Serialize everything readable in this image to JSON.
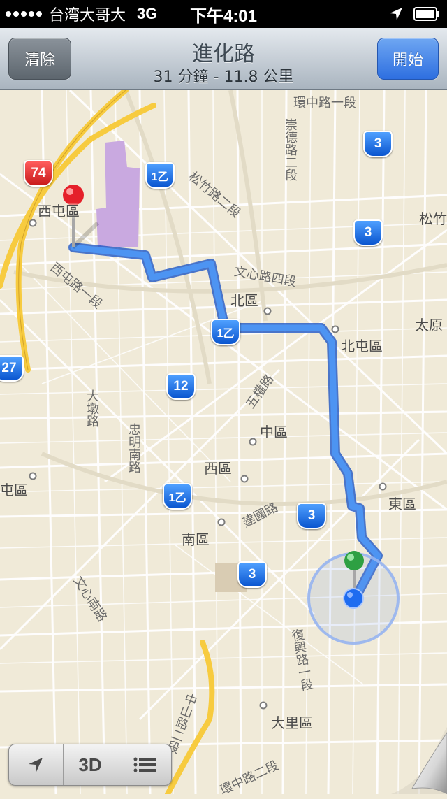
{
  "status_bar": {
    "carrier": "台湾大哥大",
    "network": "3G",
    "time": "下午4:01"
  },
  "nav": {
    "clear_label": "清除",
    "title": "進化路",
    "subtitle": "31 分鐘 - 11.8 公里",
    "start_label": "開始"
  },
  "map": {
    "districts": {
      "xitun": "西屯區",
      "north": "北區",
      "beitun": "北屯區",
      "central": "中區",
      "west": "西區",
      "east": "東區",
      "south": "南區",
      "dali": "大里區",
      "nantun_partial": "屯區",
      "taiyuan_partial": "太原",
      "songzhu_partial": "松竹"
    },
    "roads": {
      "huanzhong": "環中路一段",
      "chongde": "崇德路二段",
      "songzhu": "松竹路二段",
      "wenxin4": "文心路四段",
      "xitunroad": "西屯路一段",
      "dadun": "大墩路",
      "zhongming": "忠明南路",
      "wuquan": "五權路",
      "jianguo": "建國路",
      "wenxinsouth": "文心南路",
      "fuxing": "復興路一段",
      "roadbottom": "中山路二段",
      "roadbottom2": "環中路二段"
    },
    "shields": {
      "h74": "74",
      "h3a": "3",
      "h3b": "3",
      "h3c": "3",
      "h3d": "3",
      "h1a": "1乙",
      "h1b": "1乙",
      "h1c": "1乙",
      "h12": "12",
      "h27": "27"
    }
  },
  "toolbar": {
    "threed_label": "3D"
  },
  "colors": {
    "route": "#3f86ee",
    "map_bg": "#f0ead8",
    "start_button": "#2e6fe0",
    "clear_button": "#6b747c"
  }
}
